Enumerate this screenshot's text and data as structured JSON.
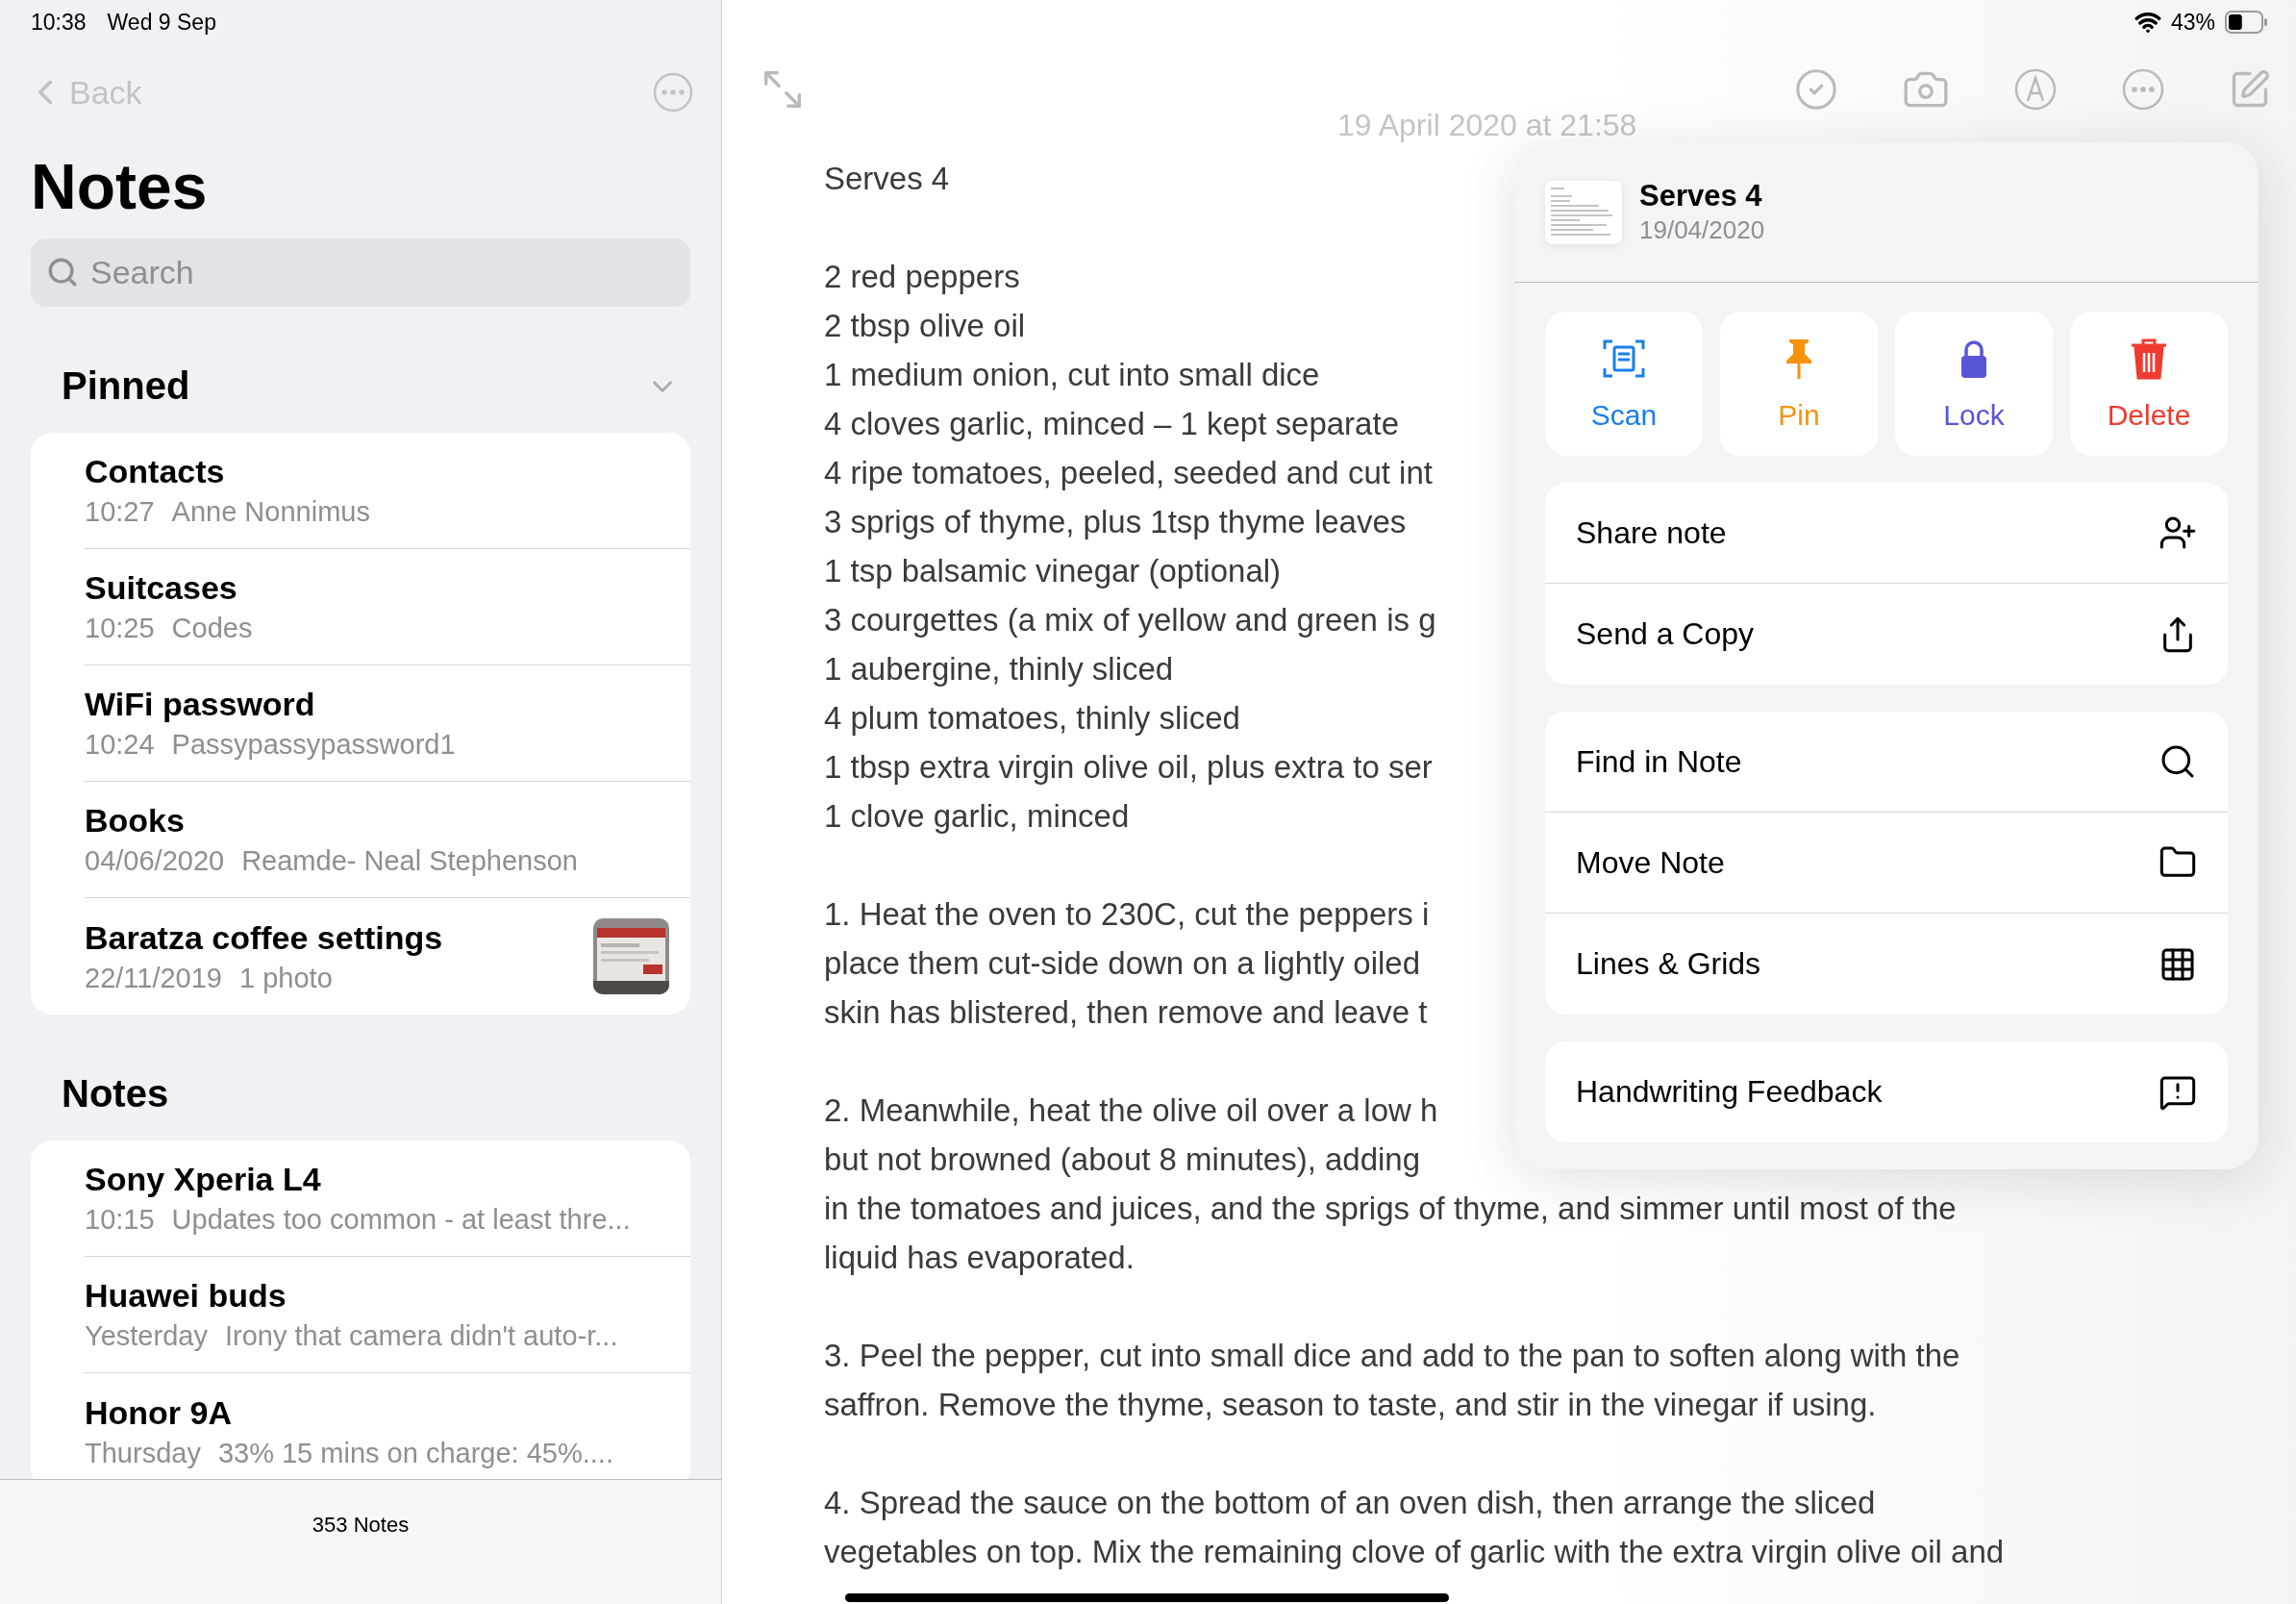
{
  "status_bar": {
    "time": "10:38",
    "date": "Wed 9 Sep",
    "battery": "43%"
  },
  "sidebar": {
    "back": "Back",
    "title": "Notes",
    "search": {
      "placeholder": "Search"
    },
    "sections": [
      {
        "title": "Pinned",
        "kind": "pinned",
        "notes": [
          {
            "title": "Contacts",
            "time": "10:27",
            "preview": "Anne Nonnimus"
          },
          {
            "title": "Suitcases",
            "time": "10:25",
            "preview": "Codes"
          },
          {
            "title": "WiFi password",
            "time": "10:24",
            "preview": "Passypassypassword1"
          },
          {
            "title": "Books",
            "time": "04/06/2020",
            "preview": "Reamde- Neal Stephenson"
          },
          {
            "title": "Baratza coffee settings",
            "time": "22/11/2019",
            "preview": "1 photo"
          }
        ]
      },
      {
        "title": "Notes",
        "kind": "all",
        "notes": [
          {
            "title": "Sony Xperia L4",
            "time": "10:15",
            "preview": "Updates too common - at least thre..."
          },
          {
            "title": "Huawei buds",
            "time": "Yesterday",
            "preview": "Irony that camera didn't auto-r..."
          },
          {
            "title": "Honor 9A",
            "time": "Thursday",
            "preview": "33% 15 mins on charge: 45%...."
          }
        ]
      }
    ],
    "footer": "353 Notes"
  },
  "note": {
    "date": "19 April 2020 at 21:58",
    "paragraphs": [
      [
        "Serves 4"
      ],
      [
        "2 red peppers",
        "2 tbsp olive oil",
        "1 medium onion, cut into small dice",
        "4 cloves garlic, minced – 1 kept separate",
        "4 ripe tomatoes, peeled, seeded and cut int",
        "3 sprigs of thyme, plus 1tsp thyme leaves",
        "1 tsp balsamic vinegar (optional)",
        "3 courgettes (a mix of yellow and green is g",
        "1 aubergine, thinly sliced",
        "4 plum tomatoes, thinly sliced",
        "1 tbsp extra virgin olive oil, plus extra to ser",
        "1 clove garlic, minced"
      ],
      [
        "1. Heat the oven to 230C, cut the peppers i",
        "place them cut-side down on a lightly oiled",
        "skin has blistered, then remove and leave t"
      ],
      [
        "2. Meanwhile, heat the olive oil over a low h",
        "but not browned (about 8 minutes), adding",
        "in the tomatoes and juices, and the sprigs of thyme, and simmer until most of the",
        "liquid has evaporated."
      ],
      [
        "3. Peel the pepper, cut into small dice and add to the pan to soften along with the",
        "saffron. Remove the thyme, season to taste, and stir in the vinegar if using."
      ],
      [
        "4. Spread the sauce on the bottom of an oven dish, then arrange the sliced",
        "vegetables on top. Mix the remaining clove of garlic with the extra virgin olive oil and"
      ]
    ]
  },
  "menu": {
    "title": "Serves 4",
    "date": "19/04/2020",
    "actions": [
      {
        "label": "Scan",
        "kind": "scan",
        "color": "#1a7fe8"
      },
      {
        "label": "Pin",
        "kind": "pin",
        "color": "#f7930a"
      },
      {
        "label": "Lock",
        "kind": "lock",
        "color": "#5856d6"
      },
      {
        "label": "Delete",
        "kind": "delete",
        "color": "#f03b30"
      }
    ],
    "groups": [
      [
        {
          "label": "Share note",
          "kind": "share-person"
        },
        {
          "label": "Send a Copy",
          "kind": "share"
        }
      ],
      [
        {
          "label": "Find in Note",
          "kind": "search"
        },
        {
          "label": "Move Note",
          "kind": "folder"
        },
        {
          "label": "Lines & Grids",
          "kind": "grid"
        }
      ],
      [
        {
          "label": "Handwriting Feedback",
          "kind": "feedback"
        }
      ]
    ]
  }
}
